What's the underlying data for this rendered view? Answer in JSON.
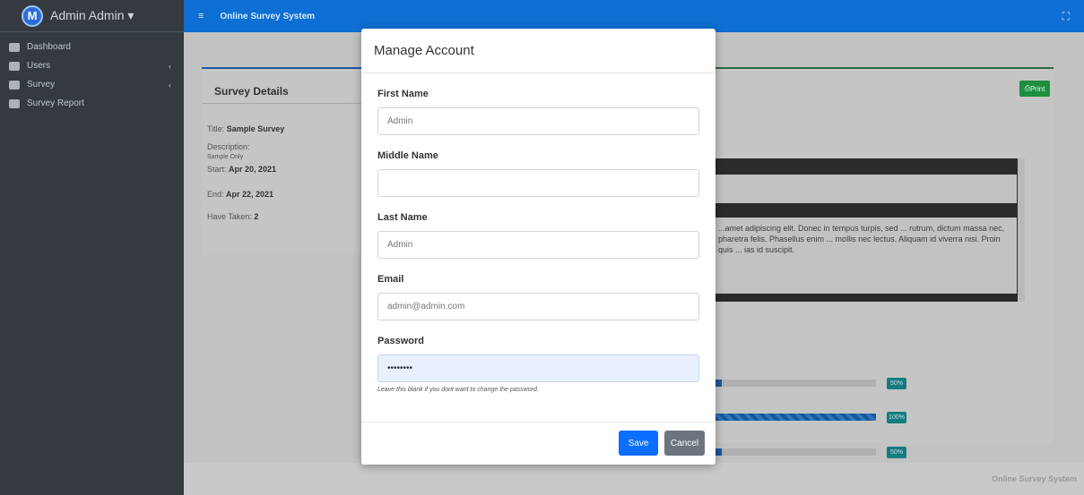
{
  "sidebar": {
    "brand_logo": "M",
    "brand_text": "Admin Admin ▾",
    "items": [
      {
        "label": "Dashboard",
        "icon": "dashboard-icon"
      },
      {
        "label": "Users",
        "icon": "users-icon"
      },
      {
        "label": "Survey",
        "icon": "survey-icon"
      },
      {
        "label": "Survey Report",
        "icon": "report-icon"
      }
    ]
  },
  "topbar": {
    "title": "Online Survey System",
    "menu_icon": "≡",
    "expand_icon": "⛶"
  },
  "details": {
    "heading": "Survey Details",
    "title_label": "Title:",
    "title_value": "Sample Survey",
    "description_label": "Description:",
    "description_value": "Sample Only",
    "start_label": "Start:",
    "start_value": "Apr 20, 2021",
    "end_label": "End:",
    "end_value": "Apr 22, 2021",
    "taken_label": "Have Taken:",
    "taken_value": "2"
  },
  "right_panel": {
    "print_label": "Print",
    "question_text": "...amet adipiscing elit. Donec in tempus turpis, sed ... rutrum, dictum massa nec, pharetra felis. Phasellus enim ... mollis nec lectus. Aliquam id viverra nisi. Proin quis ... ias id suscipit.",
    "bars": [
      {
        "percent": 50,
        "label": "50%"
      },
      {
        "percent": 100,
        "label": "100%"
      },
      {
        "percent": 50,
        "label": "50%"
      }
    ]
  },
  "footer": {
    "text": "Online Survey System"
  },
  "modal": {
    "title": "Manage Account",
    "fields": {
      "first_name": {
        "label": "First Name",
        "value": "Admin"
      },
      "middle_name": {
        "label": "Middle Name",
        "value": ""
      },
      "last_name": {
        "label": "Last Name",
        "value": "Admin"
      },
      "email": {
        "label": "Email",
        "value": "admin@admin.com"
      },
      "password": {
        "label": "Password",
        "value": "••••••••"
      }
    },
    "password_hint": "Leave this blank if you dont want to change the password.",
    "save_label": "Save",
    "cancel_label": "Cancel"
  },
  "colors": {
    "primary": "#0d6efd",
    "topbar": "#0d6fd3",
    "sidebar": "#343a40",
    "secondary": "#6c757d",
    "success": "#1e8f3f"
  }
}
